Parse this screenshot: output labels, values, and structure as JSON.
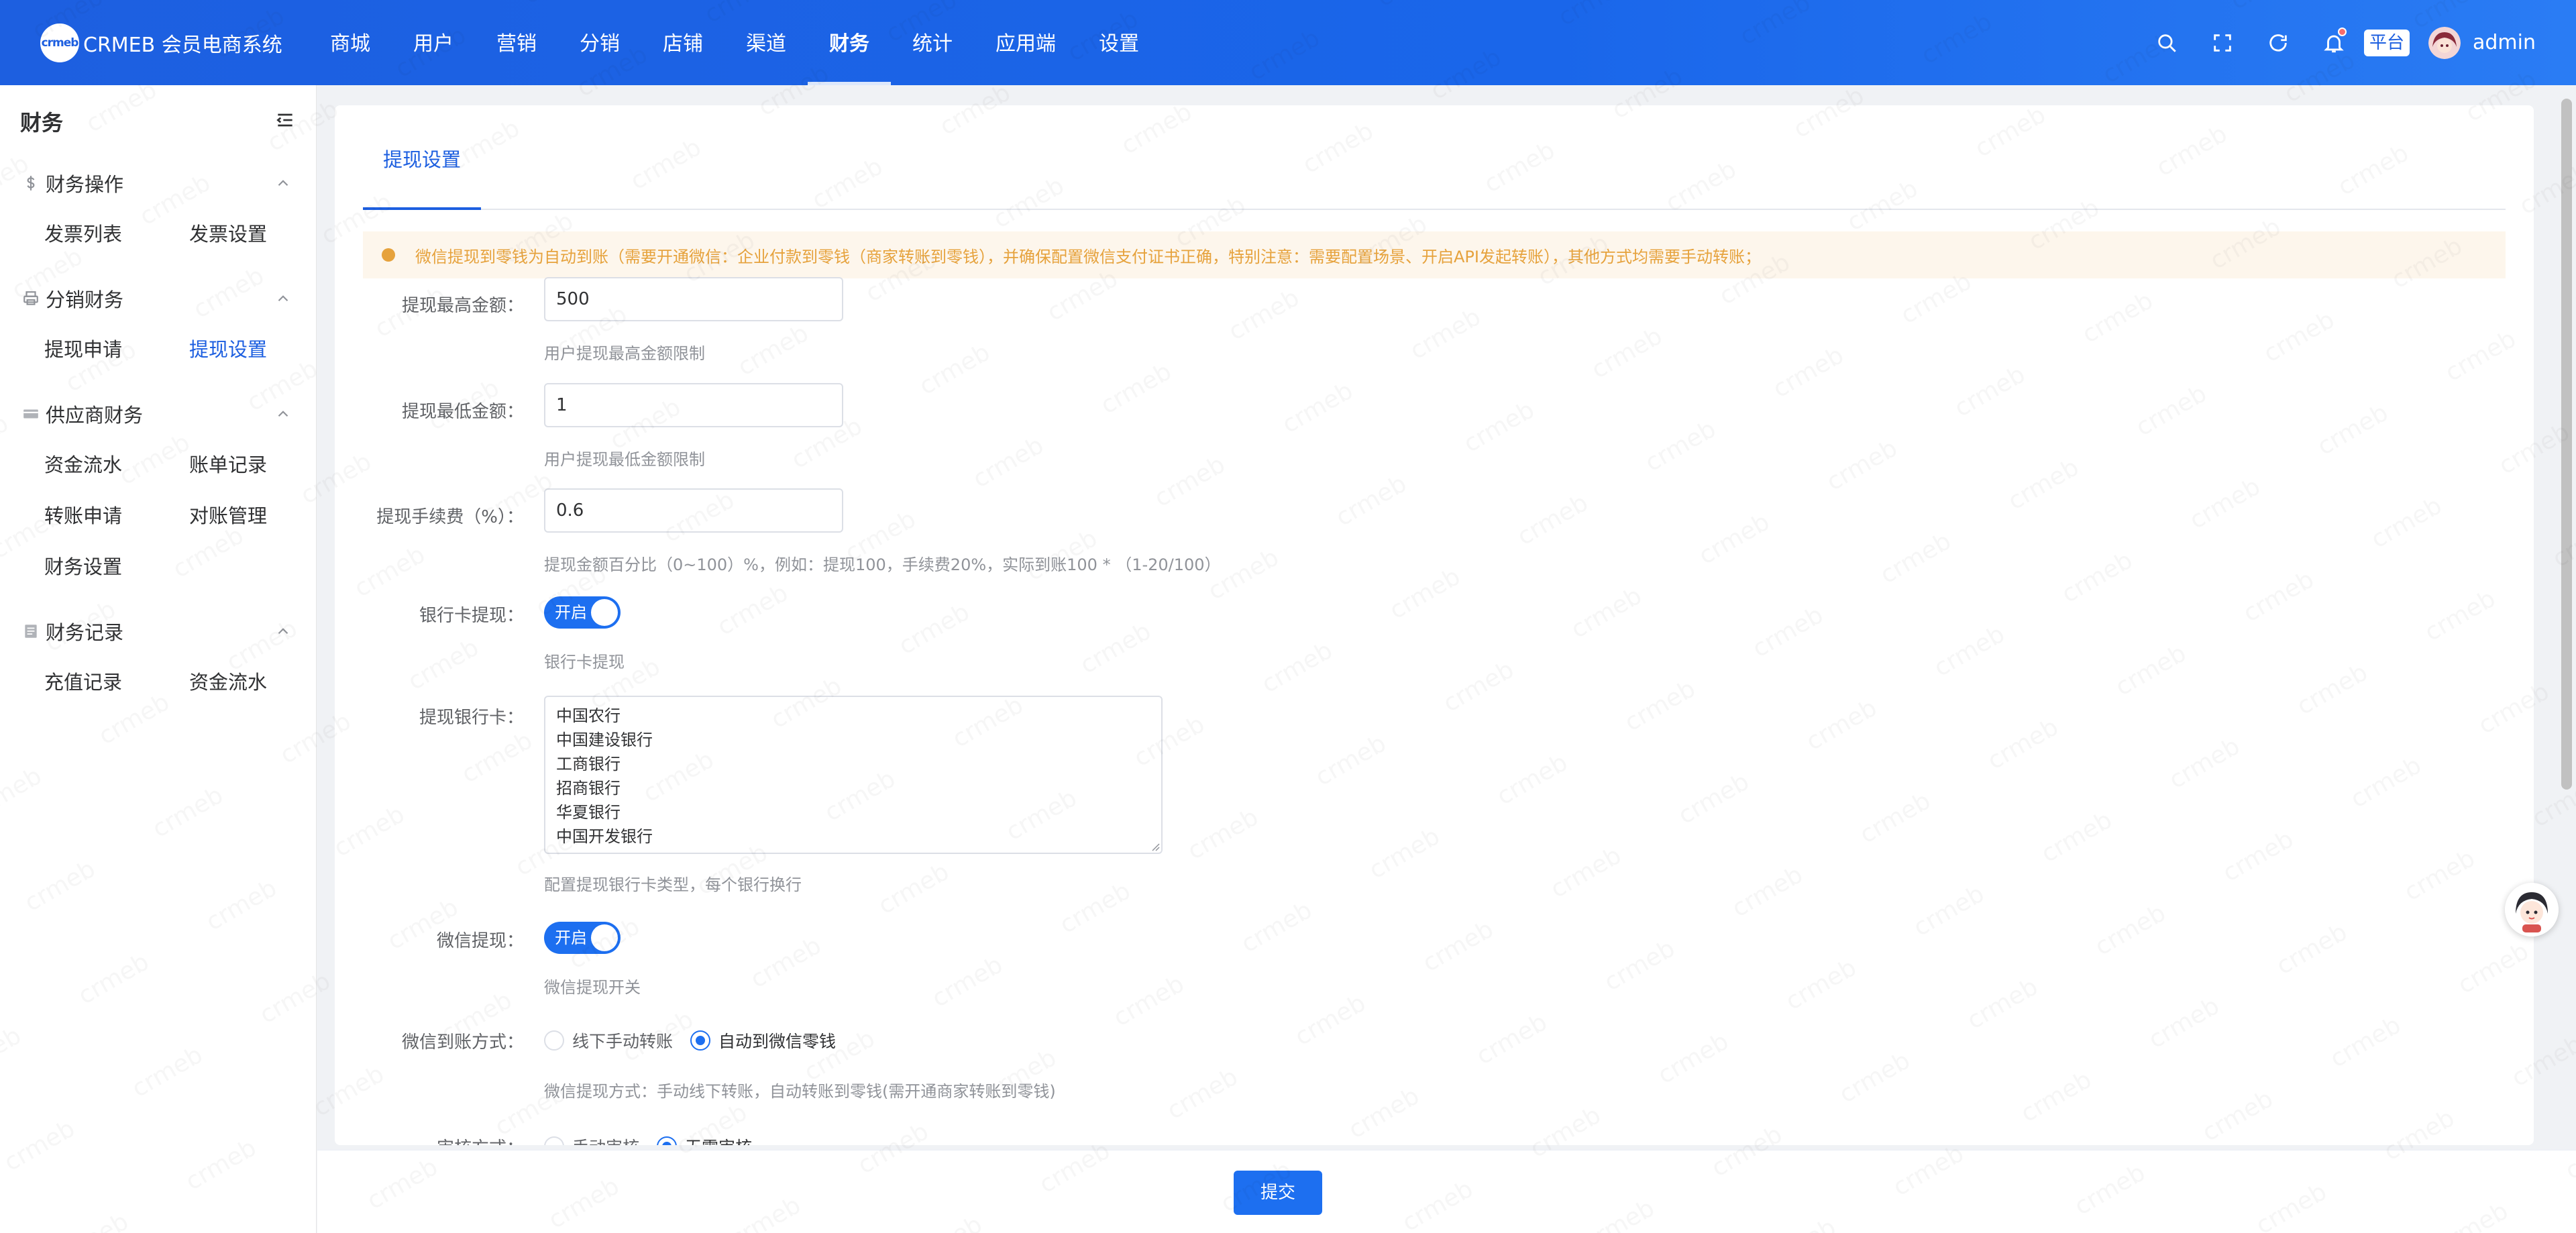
{
  "header": {
    "logo_mark": "crmeb",
    "app_title": "CRMEB 会员电商系统",
    "nav": [
      {
        "label": "商城",
        "active": false
      },
      {
        "label": "用户",
        "active": false
      },
      {
        "label": "营销",
        "active": false
      },
      {
        "label": "分销",
        "active": false
      },
      {
        "label": "店铺",
        "active": false
      },
      {
        "label": "渠道",
        "active": false
      },
      {
        "label": "财务",
        "active": true
      },
      {
        "label": "统计",
        "active": false
      },
      {
        "label": "应用端",
        "active": false
      },
      {
        "label": "设置",
        "active": false
      }
    ],
    "tools": [
      "search-icon",
      "fullscreen-icon",
      "refresh-icon",
      "bell-icon"
    ],
    "platform_badge": "平台",
    "username": "admin"
  },
  "sidebar": {
    "title": "财务",
    "groups": [
      {
        "icon": "dollar-icon",
        "label": "财务操作",
        "items": [
          {
            "label": "发票列表"
          },
          {
            "label": "发票设置"
          }
        ]
      },
      {
        "icon": "printer-icon",
        "label": "分销财务",
        "items": [
          {
            "label": "提现申请"
          },
          {
            "label": "提现设置",
            "active": true
          }
        ]
      },
      {
        "icon": "card-icon",
        "label": "供应商财务",
        "items": [
          {
            "label": "资金流水"
          },
          {
            "label": "账单记录"
          },
          {
            "label": "转账申请"
          },
          {
            "label": "对账管理"
          },
          {
            "label": "财务设置"
          }
        ]
      },
      {
        "icon": "document-icon",
        "label": "财务记录",
        "items": [
          {
            "label": "充值记录"
          },
          {
            "label": "资金流水"
          }
        ]
      }
    ]
  },
  "main": {
    "tab": "提现设置",
    "alert": "微信提现到零钱为自动到账（需要开通微信：企业付款到零钱（商家转账到零钱），并确保配置微信支付证书正确，特别注意：需要配置场景、开启API发起转账），其他方式均需要手动转账；",
    "form": {
      "max_amount": {
        "label": "提现最高金额：",
        "value": "500",
        "tip": "用户提现最高金额限制"
      },
      "min_amount": {
        "label": "提现最低金额：",
        "value": "1",
        "tip": "用户提现最低金额限制"
      },
      "fee": {
        "label": "提现手续费（%）：",
        "value": "0.6",
        "tip": "提现金额百分比（0~100）%，例如：提现100，手续费20%，实际到账100 * （1-20/100）"
      },
      "bank_withdraw": {
        "label": "银行卡提现：",
        "switch_text": "开启",
        "on": true,
        "tip": "银行卡提现"
      },
      "banks": {
        "label": "提现银行卡：",
        "lines": [
          "中国农行",
          "中国建设银行",
          "工商银行",
          "招商银行",
          "华夏银行",
          "中国开发银行"
        ],
        "tip": "配置提现银行卡类型，每个银行换行"
      },
      "wechat_withdraw": {
        "label": "微信提现：",
        "switch_text": "开启",
        "on": true,
        "tip": "微信提现开关"
      },
      "wechat_method": {
        "label": "微信到账方式：",
        "options": [
          {
            "label": "线下手动转账",
            "checked": false
          },
          {
            "label": "自动到微信零钱",
            "checked": true
          }
        ],
        "tip": "微信提现方式：手动线下转账，自动转账到零钱(需开通商家转账到零钱)"
      },
      "audit": {
        "label": "审核方式：",
        "options": [
          {
            "label": "手动审核",
            "checked": false
          },
          {
            "label": "无需审核",
            "checked": true
          }
        ]
      }
    },
    "submit_label": "提交"
  },
  "colors": {
    "primary": "#1d6ff0",
    "header_gradient_start": "#1d5fe0",
    "alert_text": "#e6a23c",
    "alert_bg": "#fdf6ec"
  },
  "watermark_text": "crmeb"
}
